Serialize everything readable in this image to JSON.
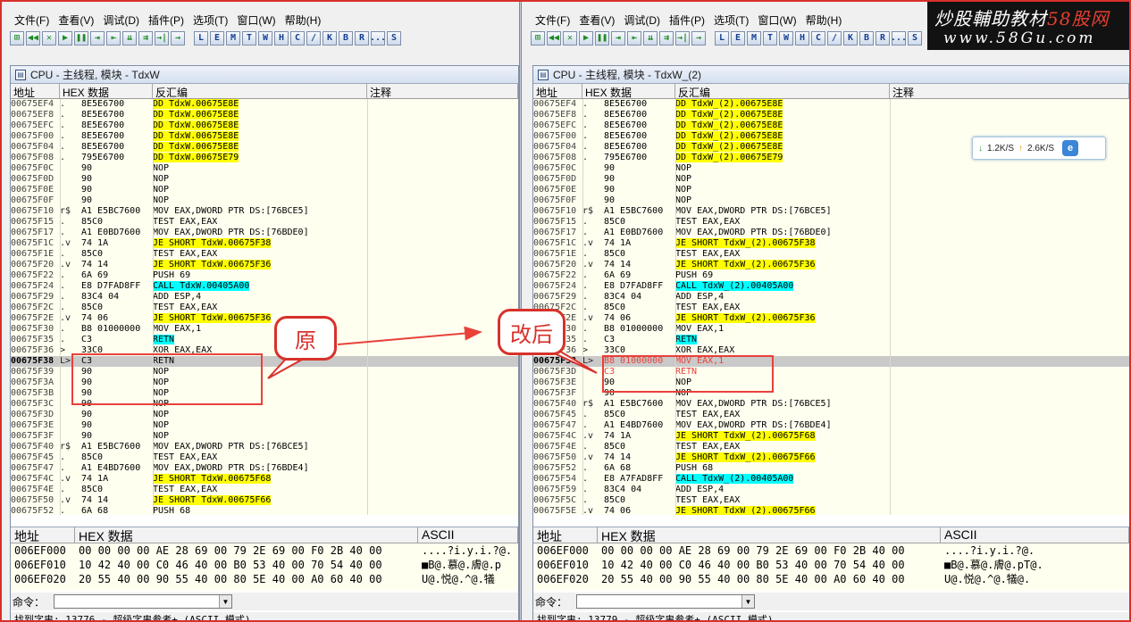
{
  "menu": [
    "文件(F)",
    "查看(V)",
    "调试(D)",
    "插件(P)",
    "选项(T)",
    "窗口(W)",
    "帮助(H)"
  ],
  "toolbar": {
    "left_icons": [
      "⊞",
      "◀◀",
      "✕",
      "▶",
      "❚❚",
      "⇥",
      "⇤",
      "⇊",
      "⇉",
      "→|",
      "→"
    ],
    "letters": [
      "L",
      "E",
      "M",
      "T",
      "W",
      "H",
      "C",
      "/",
      "K",
      "B",
      "R",
      "...",
      "S"
    ]
  },
  "columns": {
    "addr": "地址",
    "hex": "HEX 数据",
    "dis": "反汇编",
    "comment": "注释"
  },
  "left": {
    "title": "CPU - 主线程, 模块 - TdxW",
    "rows": [
      {
        "a": "00675EF4",
        "m": ".",
        "h": "8E5E6700",
        "d": "DD TdxW.00675E8E",
        "c": "y"
      },
      {
        "a": "00675EF8",
        "m": ".",
        "h": "8E5E6700",
        "d": "DD TdxW.00675E8E",
        "c": "y"
      },
      {
        "a": "00675EFC",
        "m": ".",
        "h": "8E5E6700",
        "d": "DD TdxW.00675E8E",
        "c": "y"
      },
      {
        "a": "00675F00",
        "m": ".",
        "h": "8E5E6700",
        "d": "DD TdxW.00675E8E",
        "c": "y"
      },
      {
        "a": "00675F04",
        "m": ".",
        "h": "8E5E6700",
        "d": "DD TdxW.00675E8E",
        "c": "y"
      },
      {
        "a": "00675F08",
        "m": ".",
        "h": "795E6700",
        "d": "DD TdxW.00675E79",
        "c": "y"
      },
      {
        "a": "00675F0C",
        "m": "",
        "h": "90",
        "d": "NOP",
        "c": ""
      },
      {
        "a": "00675F0D",
        "m": "",
        "h": "90",
        "d": "NOP",
        "c": ""
      },
      {
        "a": "00675F0E",
        "m": "",
        "h": "90",
        "d": "NOP",
        "c": ""
      },
      {
        "a": "00675F0F",
        "m": "",
        "h": "90",
        "d": "NOP",
        "c": ""
      },
      {
        "a": "00675F10",
        "m": "r$",
        "h": "A1 E5BC7600",
        "d": "MOV EAX,DWORD PTR DS:[76BCE5]",
        "c": ""
      },
      {
        "a": "00675F15",
        "m": ".",
        "h": "85C0",
        "d": "TEST EAX,EAX",
        "c": ""
      },
      {
        "a": "00675F17",
        "m": ".",
        "h": "A1 E0BD7600",
        "d": "MOV EAX,DWORD PTR DS:[76BDE0]",
        "c": ""
      },
      {
        "a": "00675F1C",
        "m": ".v",
        "h": "74 1A",
        "d": "JE SHORT TdxW.00675F38",
        "c": "yj"
      },
      {
        "a": "00675F1E",
        "m": ".",
        "h": "85C0",
        "d": "TEST EAX,EAX",
        "c": ""
      },
      {
        "a": "00675F20",
        "m": ".v",
        "h": "74 14",
        "d": "JE SHORT TdxW.00675F36",
        "c": "yj"
      },
      {
        "a": "00675F22",
        "m": ".",
        "h": "6A 69",
        "d": "PUSH 69",
        "c": ""
      },
      {
        "a": "00675F24",
        "m": ".",
        "h": "E8 D7FAD8FF",
        "d": "CALL TdxW.00405A00",
        "c": "cc"
      },
      {
        "a": "00675F29",
        "m": ".",
        "h": "83C4 04",
        "d": "ADD ESP,4",
        "c": ""
      },
      {
        "a": "00675F2C",
        "m": ".",
        "h": "85C0",
        "d": "TEST EAX,EAX",
        "c": ""
      },
      {
        "a": "00675F2E",
        "m": ".v",
        "h": "74 06",
        "d": "JE SHORT TdxW.00675F36",
        "c": "yj"
      },
      {
        "a": "00675F30",
        "m": ".",
        "h": "B8 01000000",
        "d": "MOV EAX,1",
        "c": ""
      },
      {
        "a": "00675F35",
        "m": ".",
        "h": "C3",
        "d": "RETN",
        "c": "c"
      },
      {
        "a": "00675F36",
        "m": ">",
        "h": "33C0",
        "d": "XOR EAX,EAX",
        "c": ""
      },
      {
        "a": "00675F38",
        "m": "L>",
        "h": "C3",
        "d": "RETN",
        "c": "sel"
      },
      {
        "a": "00675F39",
        "m": "",
        "h": "90",
        "d": "NOP",
        "c": ""
      },
      {
        "a": "00675F3A",
        "m": "",
        "h": "90",
        "d": "NOP",
        "c": ""
      },
      {
        "a": "00675F3B",
        "m": "",
        "h": "90",
        "d": "NOP",
        "c": ""
      },
      {
        "a": "00675F3C",
        "m": "",
        "h": "90",
        "d": "NOP",
        "c": ""
      },
      {
        "a": "00675F3D",
        "m": "",
        "h": "90",
        "d": "NOP",
        "c": ""
      },
      {
        "a": "00675F3E",
        "m": "",
        "h": "90",
        "d": "NOP",
        "c": ""
      },
      {
        "a": "00675F3F",
        "m": "",
        "h": "90",
        "d": "NOP",
        "c": ""
      },
      {
        "a": "00675F40",
        "m": "r$",
        "h": "A1 E5BC7600",
        "d": "MOV EAX,DWORD PTR DS:[76BCE5]",
        "c": ""
      },
      {
        "a": "00675F45",
        "m": ".",
        "h": "85C0",
        "d": "TEST EAX,EAX",
        "c": ""
      },
      {
        "a": "00675F47",
        "m": ".",
        "h": "A1 E4BD7600",
        "d": "MOV EAX,DWORD PTR DS:[76BDE4]",
        "c": ""
      },
      {
        "a": "00675F4C",
        "m": ".v",
        "h": "74 1A",
        "d": "JE SHORT TdxW.00675F68",
        "c": "yj"
      },
      {
        "a": "00675F4E",
        "m": ".",
        "h": "85C0",
        "d": "TEST EAX,EAX",
        "c": ""
      },
      {
        "a": "00675F50",
        "m": ".v",
        "h": "74 14",
        "d": "JE SHORT TdxW.00675F66",
        "c": "yj"
      },
      {
        "a": "00675F52",
        "m": ".",
        "h": "6A 68",
        "d": "PUSH 68",
        "c": ""
      }
    ],
    "dump": [
      {
        "a": "006EF000",
        "h": "00 00 00 00 AE 28 69 00 79 2E 69 00 F0 2B 40 00",
        "s": "....?i.y.i.?@."
      },
      {
        "a": "006EF010",
        "h": "10 42 40 00 C0 46 40 00 B0 53 40 00 70 54 40 00",
        "s": "■B@.慕@.膚@.p"
      },
      {
        "a": "006EF020",
        "h": "20 55 40 00 90 55 40 00 80 5E 40 00 A0 60 40 00",
        "s": " U@.悦@.^@.犠"
      }
    ],
    "status": "找到字串: 13776 -  超级字串参考+ (ASCII 模式)"
  },
  "right": {
    "title": "CPU - 主线程, 模块 - TdxW_(2)",
    "rows": [
      {
        "a": "00675EF4",
        "m": ".",
        "h": "8E5E6700",
        "d": "DD TdxW_(2).00675E8E",
        "c": "y"
      },
      {
        "a": "00675EF8",
        "m": ".",
        "h": "8E5E6700",
        "d": "DD TdxW_(2).00675E8E",
        "c": "y"
      },
      {
        "a": "00675EFC",
        "m": ".",
        "h": "8E5E6700",
        "d": "DD TdxW_(2).00675E8E",
        "c": "y"
      },
      {
        "a": "00675F00",
        "m": ".",
        "h": "8E5E6700",
        "d": "DD TdxW_(2).00675E8E",
        "c": "y"
      },
      {
        "a": "00675F04",
        "m": ".",
        "h": "8E5E6700",
        "d": "DD TdxW_(2).00675E8E",
        "c": "y"
      },
      {
        "a": "00675F08",
        "m": ".",
        "h": "795E6700",
        "d": "DD TdxW_(2).00675E79",
        "c": "y"
      },
      {
        "a": "00675F0C",
        "m": "",
        "h": "90",
        "d": "NOP",
        "c": ""
      },
      {
        "a": "00675F0D",
        "m": "",
        "h": "90",
        "d": "NOP",
        "c": ""
      },
      {
        "a": "00675F0E",
        "m": "",
        "h": "90",
        "d": "NOP",
        "c": ""
      },
      {
        "a": "00675F0F",
        "m": "",
        "h": "90",
        "d": "NOP",
        "c": ""
      },
      {
        "a": "00675F10",
        "m": "r$",
        "h": "A1 E5BC7600",
        "d": "MOV EAX,DWORD PTR DS:[76BCE5]",
        "c": ""
      },
      {
        "a": "00675F15",
        "m": ".",
        "h": "85C0",
        "d": "TEST EAX,EAX",
        "c": ""
      },
      {
        "a": "00675F17",
        "m": ".",
        "h": "A1 E0BD7600",
        "d": "MOV EAX,DWORD PTR DS:[76BDE0]",
        "c": ""
      },
      {
        "a": "00675F1C",
        "m": ".v",
        "h": "74 1A",
        "d": "JE SHORT TdxW_(2).00675F38",
        "c": "yj"
      },
      {
        "a": "00675F1E",
        "m": ".",
        "h": "85C0",
        "d": "TEST EAX,EAX",
        "c": ""
      },
      {
        "a": "00675F20",
        "m": ".v",
        "h": "74 14",
        "d": "JE SHORT TdxW_(2).00675F36",
        "c": "yj"
      },
      {
        "a": "00675F22",
        "m": ".",
        "h": "6A 69",
        "d": "PUSH 69",
        "c": ""
      },
      {
        "a": "00675F24",
        "m": ".",
        "h": "E8 D7FAD8FF",
        "d": "CALL TdxW_(2).00405A00",
        "c": "cc"
      },
      {
        "a": "00675F29",
        "m": ".",
        "h": "83C4 04",
        "d": "ADD ESP,4",
        "c": ""
      },
      {
        "a": "00675F2C",
        "m": ".",
        "h": "85C0",
        "d": "TEST EAX,EAX",
        "c": ""
      },
      {
        "a": "00675F2E",
        "m": ".v",
        "h": "74 06",
        "d": "JE SHORT TdxW_(2).00675F36",
        "c": "yj"
      },
      {
        "a": "00675F30",
        "m": ".",
        "h": "B8 01000000",
        "d": "MOV EAX,1",
        "c": ""
      },
      {
        "a": "00675F35",
        "m": ".",
        "h": "C3",
        "d": "RETN",
        "c": "c"
      },
      {
        "a": "00675F36",
        "m": ">",
        "h": "33C0",
        "d": "XOR EAX,EAX",
        "c": ""
      },
      {
        "a": "00675F38",
        "m": "L>",
        "h": "B8 01000000",
        "d": "MOV EAX,1",
        "c": "selr"
      },
      {
        "a": "00675F3D",
        "m": "",
        "h": "C3",
        "d": "RETN",
        "c": "r"
      },
      {
        "a": "00675F3E",
        "m": "",
        "h": "90",
        "d": "NOP",
        "c": ""
      },
      {
        "a": "00675F3F",
        "m": "",
        "h": "90",
        "d": "NOP",
        "c": ""
      },
      {
        "a": "00675F40",
        "m": "r$",
        "h": "A1 E5BC7600",
        "d": "MOV EAX,DWORD PTR DS:[76BCE5]",
        "c": ""
      },
      {
        "a": "00675F45",
        "m": ".",
        "h": "85C0",
        "d": "TEST EAX,EAX",
        "c": ""
      },
      {
        "a": "00675F47",
        "m": ".",
        "h": "A1 E4BD7600",
        "d": "MOV EAX,DWORD PTR DS:[76BDE4]",
        "c": ""
      },
      {
        "a": "00675F4C",
        "m": ".v",
        "h": "74 1A",
        "d": "JE SHORT TdxW_(2).00675F68",
        "c": "yj"
      },
      {
        "a": "00675F4E",
        "m": ".",
        "h": "85C0",
        "d": "TEST EAX,EAX",
        "c": ""
      },
      {
        "a": "00675F50",
        "m": ".v",
        "h": "74 14",
        "d": "JE SHORT TdxW_(2).00675F66",
        "c": "yj"
      },
      {
        "a": "00675F52",
        "m": ".",
        "h": "6A 68",
        "d": "PUSH 68",
        "c": ""
      },
      {
        "a": "00675F54",
        "m": ".",
        "h": "E8 A7FAD8FF",
        "d": "CALL TdxW_(2).00405A00",
        "c": "cc"
      },
      {
        "a": "00675F59",
        "m": ".",
        "h": "83C4 04",
        "d": "ADD ESP,4",
        "c": ""
      },
      {
        "a": "00675F5C",
        "m": ".",
        "h": "85C0",
        "d": "TEST EAX,EAX",
        "c": ""
      },
      {
        "a": "00675F5E",
        "m": ".v",
        "h": "74 06",
        "d": "JE SHORT TdxW_(2).00675F66",
        "c": "yj"
      }
    ],
    "dump": [
      {
        "a": "006EF000",
        "h": "00 00 00 00 AE 28 69 00 79 2E 69 00 F0 2B 40 00",
        "s": "....?i.y.i.?@."
      },
      {
        "a": "006EF010",
        "h": "10 42 40 00 C0 46 40 00 B0 53 40 00 70 54 40 00",
        "s": "■B@.慕@.膚@.pT@."
      },
      {
        "a": "006EF020",
        "h": "20 55 40 00 90 55 40 00 80 5E 40 00 A0 60 40 00",
        "s": " U@.悦@.^@.犠@."
      }
    ],
    "status": "找到字串: 13779  -  超级字串参考+ (ASCII 模式)"
  },
  "dump_cols": {
    "addr": "地址",
    "hex": "HEX 数据",
    "ascii": "ASCII"
  },
  "cmd_label": "命令：",
  "annotations": {
    "original": "原",
    "modified": "改后"
  },
  "watermark": {
    "line1_a": "炒股輔助教材",
    "line1_b": "58股网",
    "line2": "www.58Gu.com"
  },
  "speed": {
    "up": "1.2K/S",
    "down": "2.6K/S",
    "up_arrow": "↓",
    "down_arrow": "↑"
  },
  "colors": {
    "annotation_red": "#e8413a",
    "highlight_yellow": "#ffff00",
    "highlight_cyan": "#00ffff",
    "selected_row": "#c9c9c9"
  }
}
